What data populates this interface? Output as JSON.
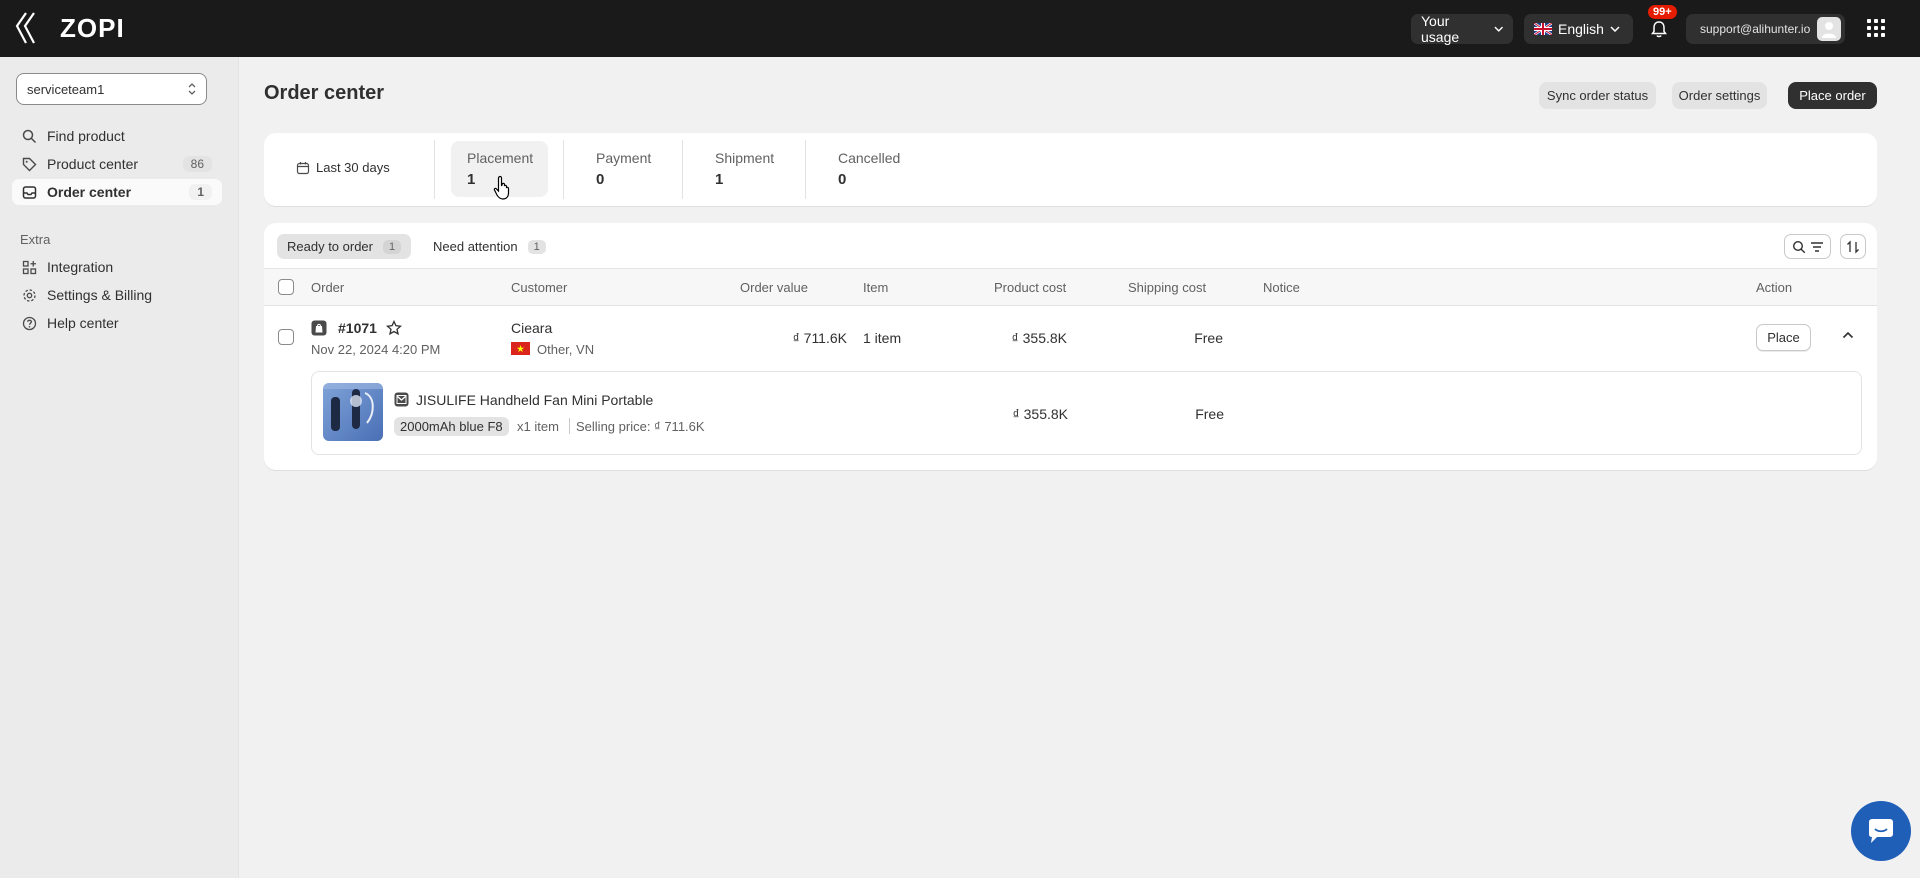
{
  "app": {
    "brand": "ZOPI"
  },
  "topbar": {
    "usage_label": "Your usage",
    "language_label": "English",
    "notifications_badge": "99+",
    "user_email": "support@alihunter.io"
  },
  "sidebar": {
    "store": "serviceteam1",
    "items": [
      {
        "label": "Find product",
        "count": ""
      },
      {
        "label": "Product center",
        "count": "86"
      },
      {
        "label": "Order center",
        "count": "1"
      }
    ],
    "extra_label": "Extra",
    "extra_items": [
      {
        "label": "Integration"
      },
      {
        "label": "Settings & Billing"
      },
      {
        "label": "Help center"
      }
    ]
  },
  "page": {
    "title": "Order center",
    "sync_label": "Sync order status",
    "settings_label": "Order settings",
    "place_label": "Place order"
  },
  "stats": {
    "date_range": "Last 30 days",
    "items": [
      {
        "label": "Placement",
        "value": "1"
      },
      {
        "label": "Payment",
        "value": "0"
      },
      {
        "label": "Shipment",
        "value": "1"
      },
      {
        "label": "Cancelled",
        "value": "0"
      }
    ]
  },
  "tabs": [
    {
      "label": "Ready to order",
      "count": "1"
    },
    {
      "label": "Need attention",
      "count": "1"
    }
  ],
  "table": {
    "headers": [
      "Order",
      "Customer",
      "Order value",
      "Item",
      "Product cost",
      "Shipping cost",
      "Notice",
      "Action"
    ],
    "row": {
      "order_id": "#1071",
      "date": "Nov 22, 2024 4:20 PM",
      "customer": "Cieara",
      "location": "Other, VN",
      "order_value": "₫ 711.6K",
      "items": "1 item",
      "product_cost": "₫ 355.8K",
      "shipping_cost": "Free",
      "action_label": "Place"
    },
    "line_item": {
      "title": "JISULIFE Handheld Fan Mini Portable",
      "variant": "2000mAh blue F8",
      "qty": "x1 item",
      "selling_price": "Selling price: ₫ 711.6K",
      "product_cost": "₫ 355.8K",
      "shipping_cost": "Free"
    }
  },
  "colors": {
    "topbar": "#1a1a1a",
    "primary_button": "#303030",
    "badge": "#e51c00",
    "chat": "#1f5fb8"
  }
}
